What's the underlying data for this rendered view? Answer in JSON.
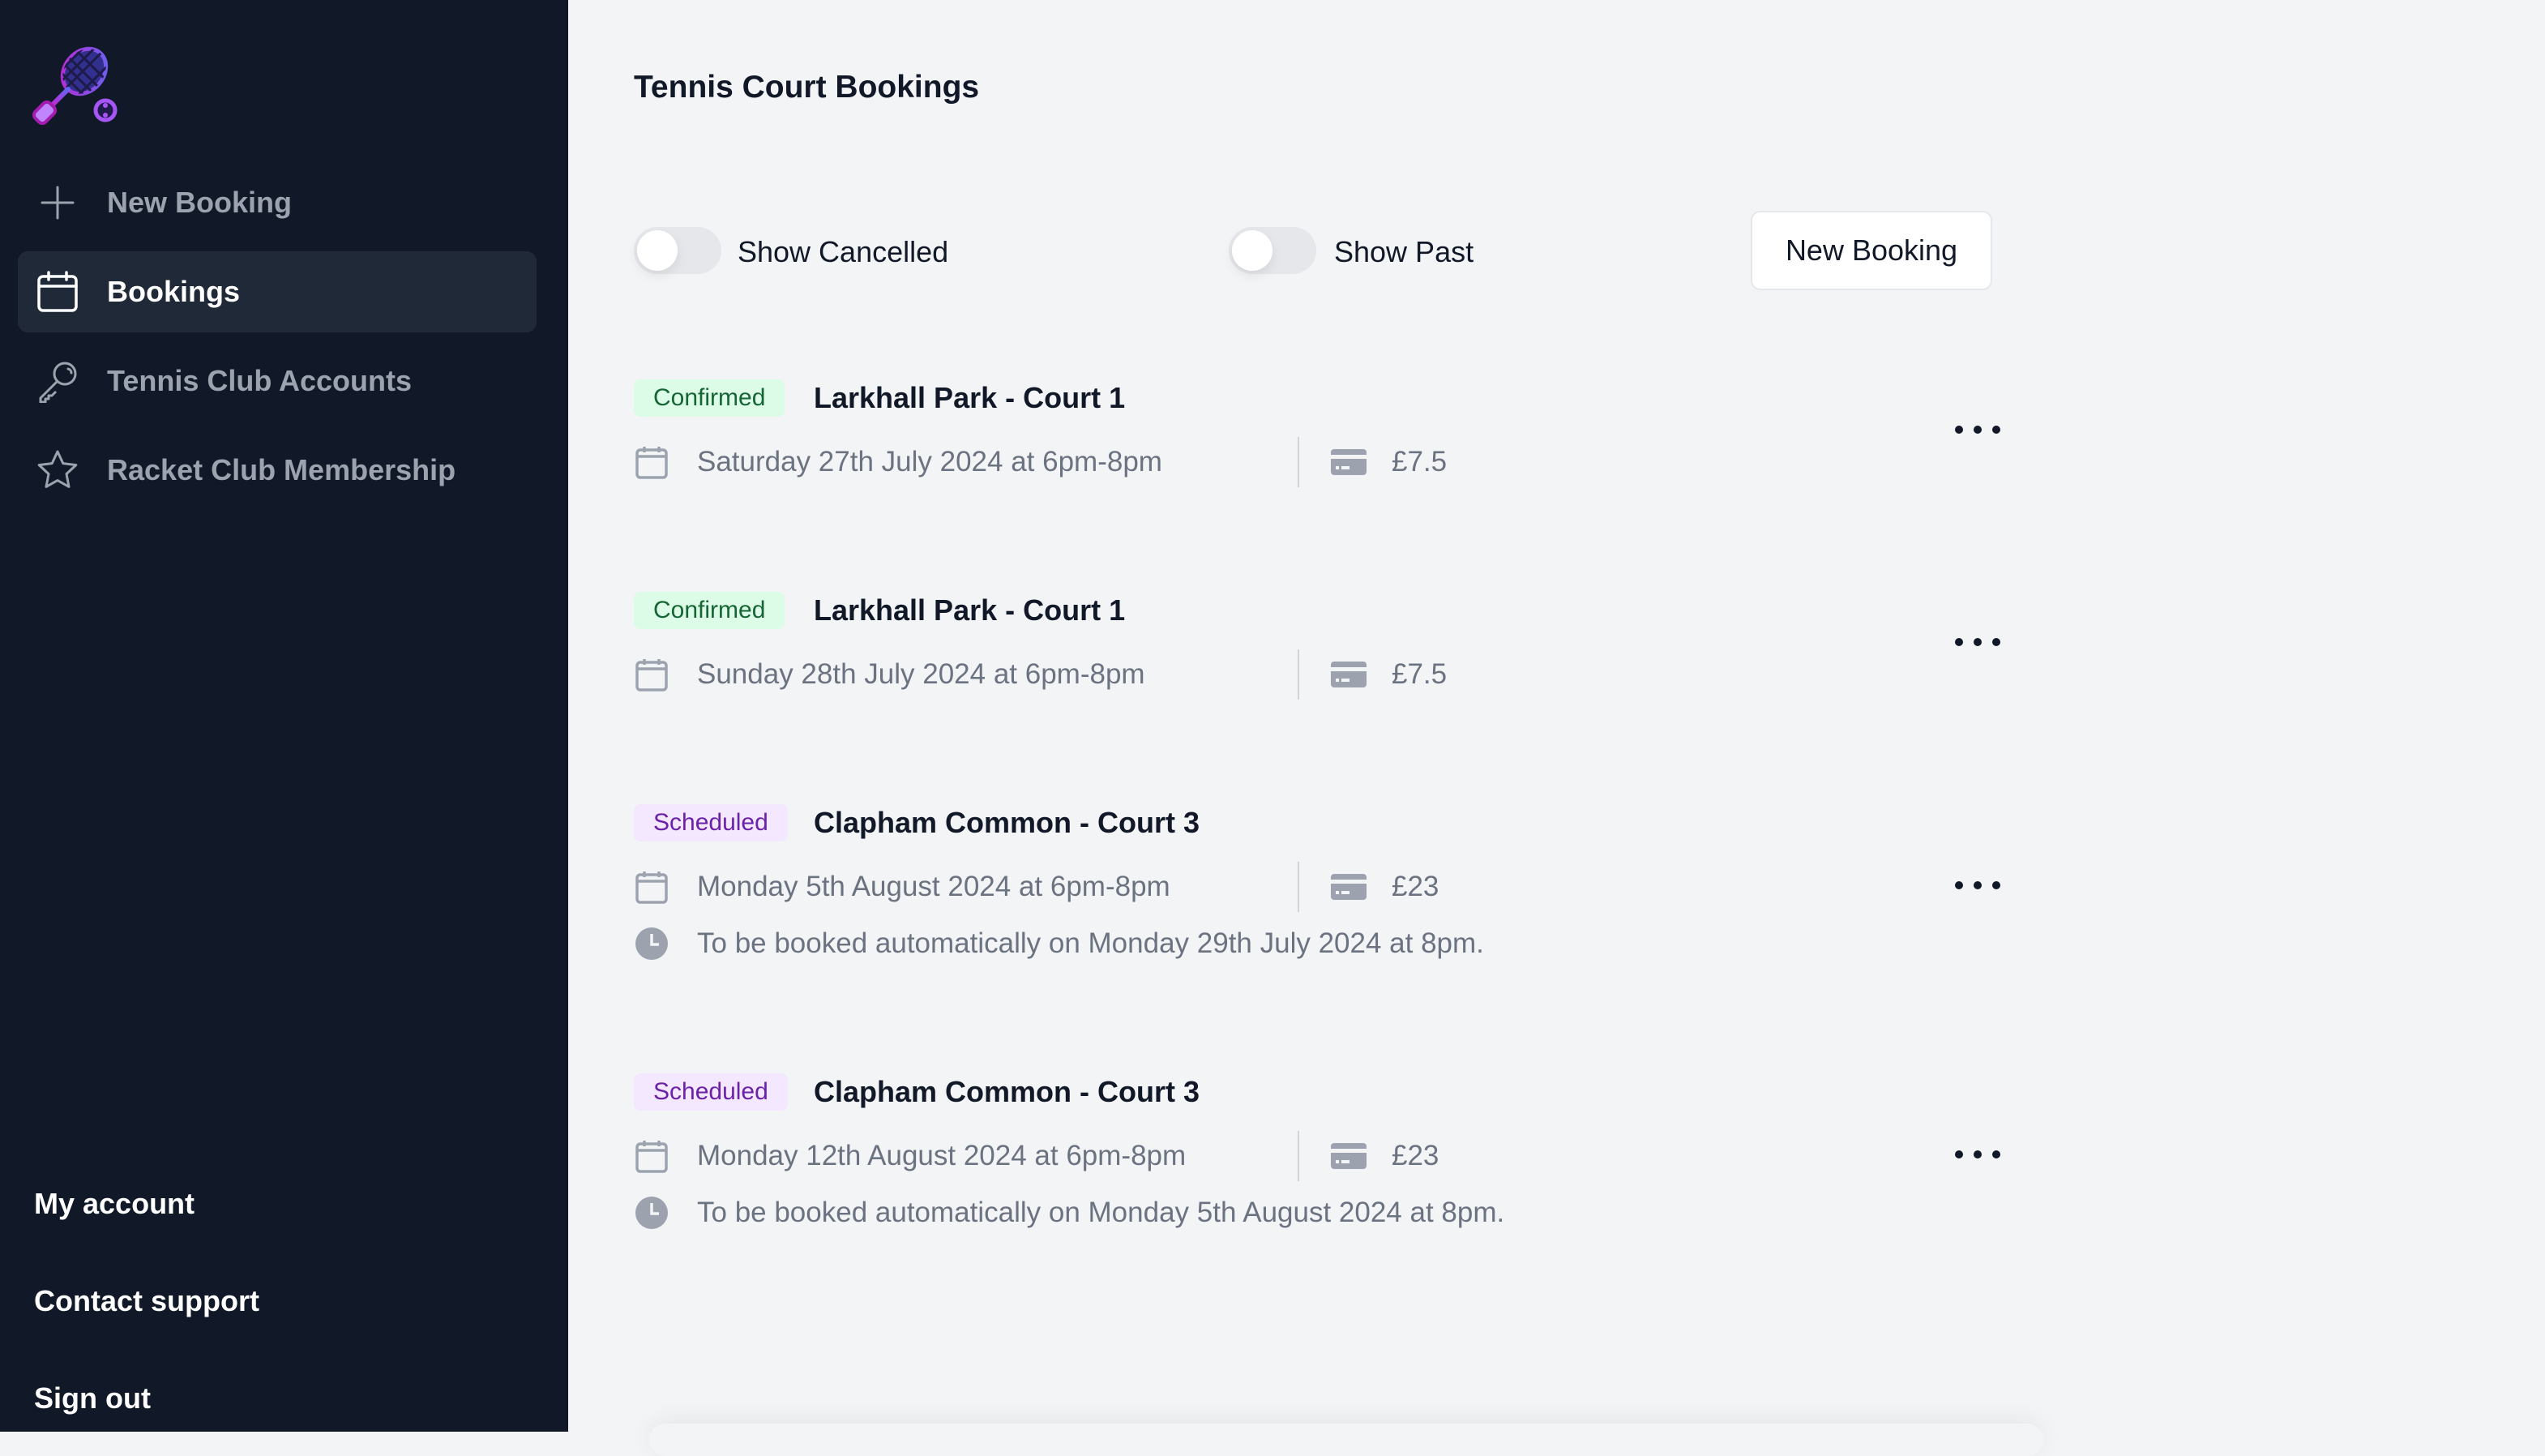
{
  "sidebar": {
    "logo": "tennis-racket-logo",
    "items": [
      {
        "label": "New Booking",
        "icon": "plus-icon",
        "active": false
      },
      {
        "label": "Bookings",
        "icon": "calendar-icon",
        "active": true
      },
      {
        "label": "Tennis Club Accounts",
        "icon": "key-icon",
        "active": false
      },
      {
        "label": "Racket Club Membership",
        "icon": "star-icon",
        "active": false
      }
    ],
    "footer": [
      "My account",
      "Contact support",
      "Sign out"
    ]
  },
  "main": {
    "title": "Tennis Court Bookings",
    "toggles": [
      {
        "label": "Show Cancelled",
        "on": false
      },
      {
        "label": "Show Past",
        "on": false
      }
    ],
    "new_booking_button": "New Booking",
    "bookings": [
      {
        "status": "Confirmed",
        "court": "Larkhall Park - Court 1",
        "date": "Saturday 27th July 2024 at 6pm-8pm",
        "price": "£7.5",
        "auto": null
      },
      {
        "status": "Confirmed",
        "court": "Larkhall Park - Court 1",
        "date": "Sunday 28th July 2024 at 6pm-8pm",
        "price": "£7.5",
        "auto": null
      },
      {
        "status": "Scheduled",
        "court": "Clapham Common - Court 3",
        "date": "Monday 5th August 2024 at 6pm-8pm",
        "price": "£23",
        "auto": "To be booked automatically on Monday 29th July 2024 at 8pm."
      },
      {
        "status": "Scheduled",
        "court": "Clapham Common - Court 3",
        "date": "Monday 12th August 2024 at 6pm-8pm",
        "price": "£23",
        "auto": "To be booked automatically on Monday 5th August 2024 at 8pm."
      }
    ]
  },
  "colors": {
    "sidebar_bg": "#111827",
    "main_bg": "#f3f4f6",
    "confirmed_bg": "#dcfce7",
    "confirmed_text": "#166534",
    "scheduled_bg": "#f3e8ff",
    "scheduled_text": "#6b21a8",
    "logo_accent": "#7c3aed"
  }
}
